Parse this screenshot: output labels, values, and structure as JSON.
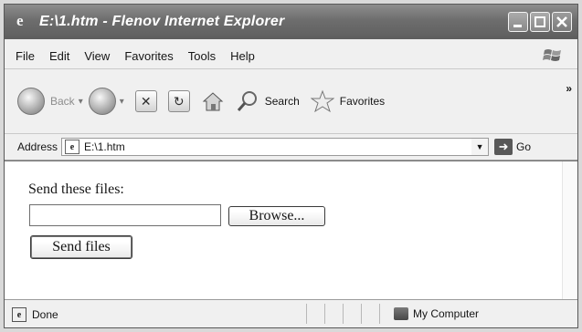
{
  "window": {
    "title": "E:\\1.htm - Flenov Internet Explorer"
  },
  "menu": {
    "items": [
      {
        "label": "File"
      },
      {
        "label": "Edit"
      },
      {
        "label": "View"
      },
      {
        "label": "Favorites"
      },
      {
        "label": "Tools"
      },
      {
        "label": "Help"
      }
    ]
  },
  "toolbar": {
    "back_label": "Back",
    "search_label": "Search",
    "favorites_label": "Favorites",
    "more_label": "»"
  },
  "address": {
    "label": "Address",
    "value": "E:\\1.htm",
    "go_label": "Go"
  },
  "page": {
    "send_label": "Send these files:",
    "file_value": "",
    "browse_label": "Browse...",
    "send_button_label": "Send files"
  },
  "status": {
    "text": "Done",
    "zone": "My Computer"
  }
}
